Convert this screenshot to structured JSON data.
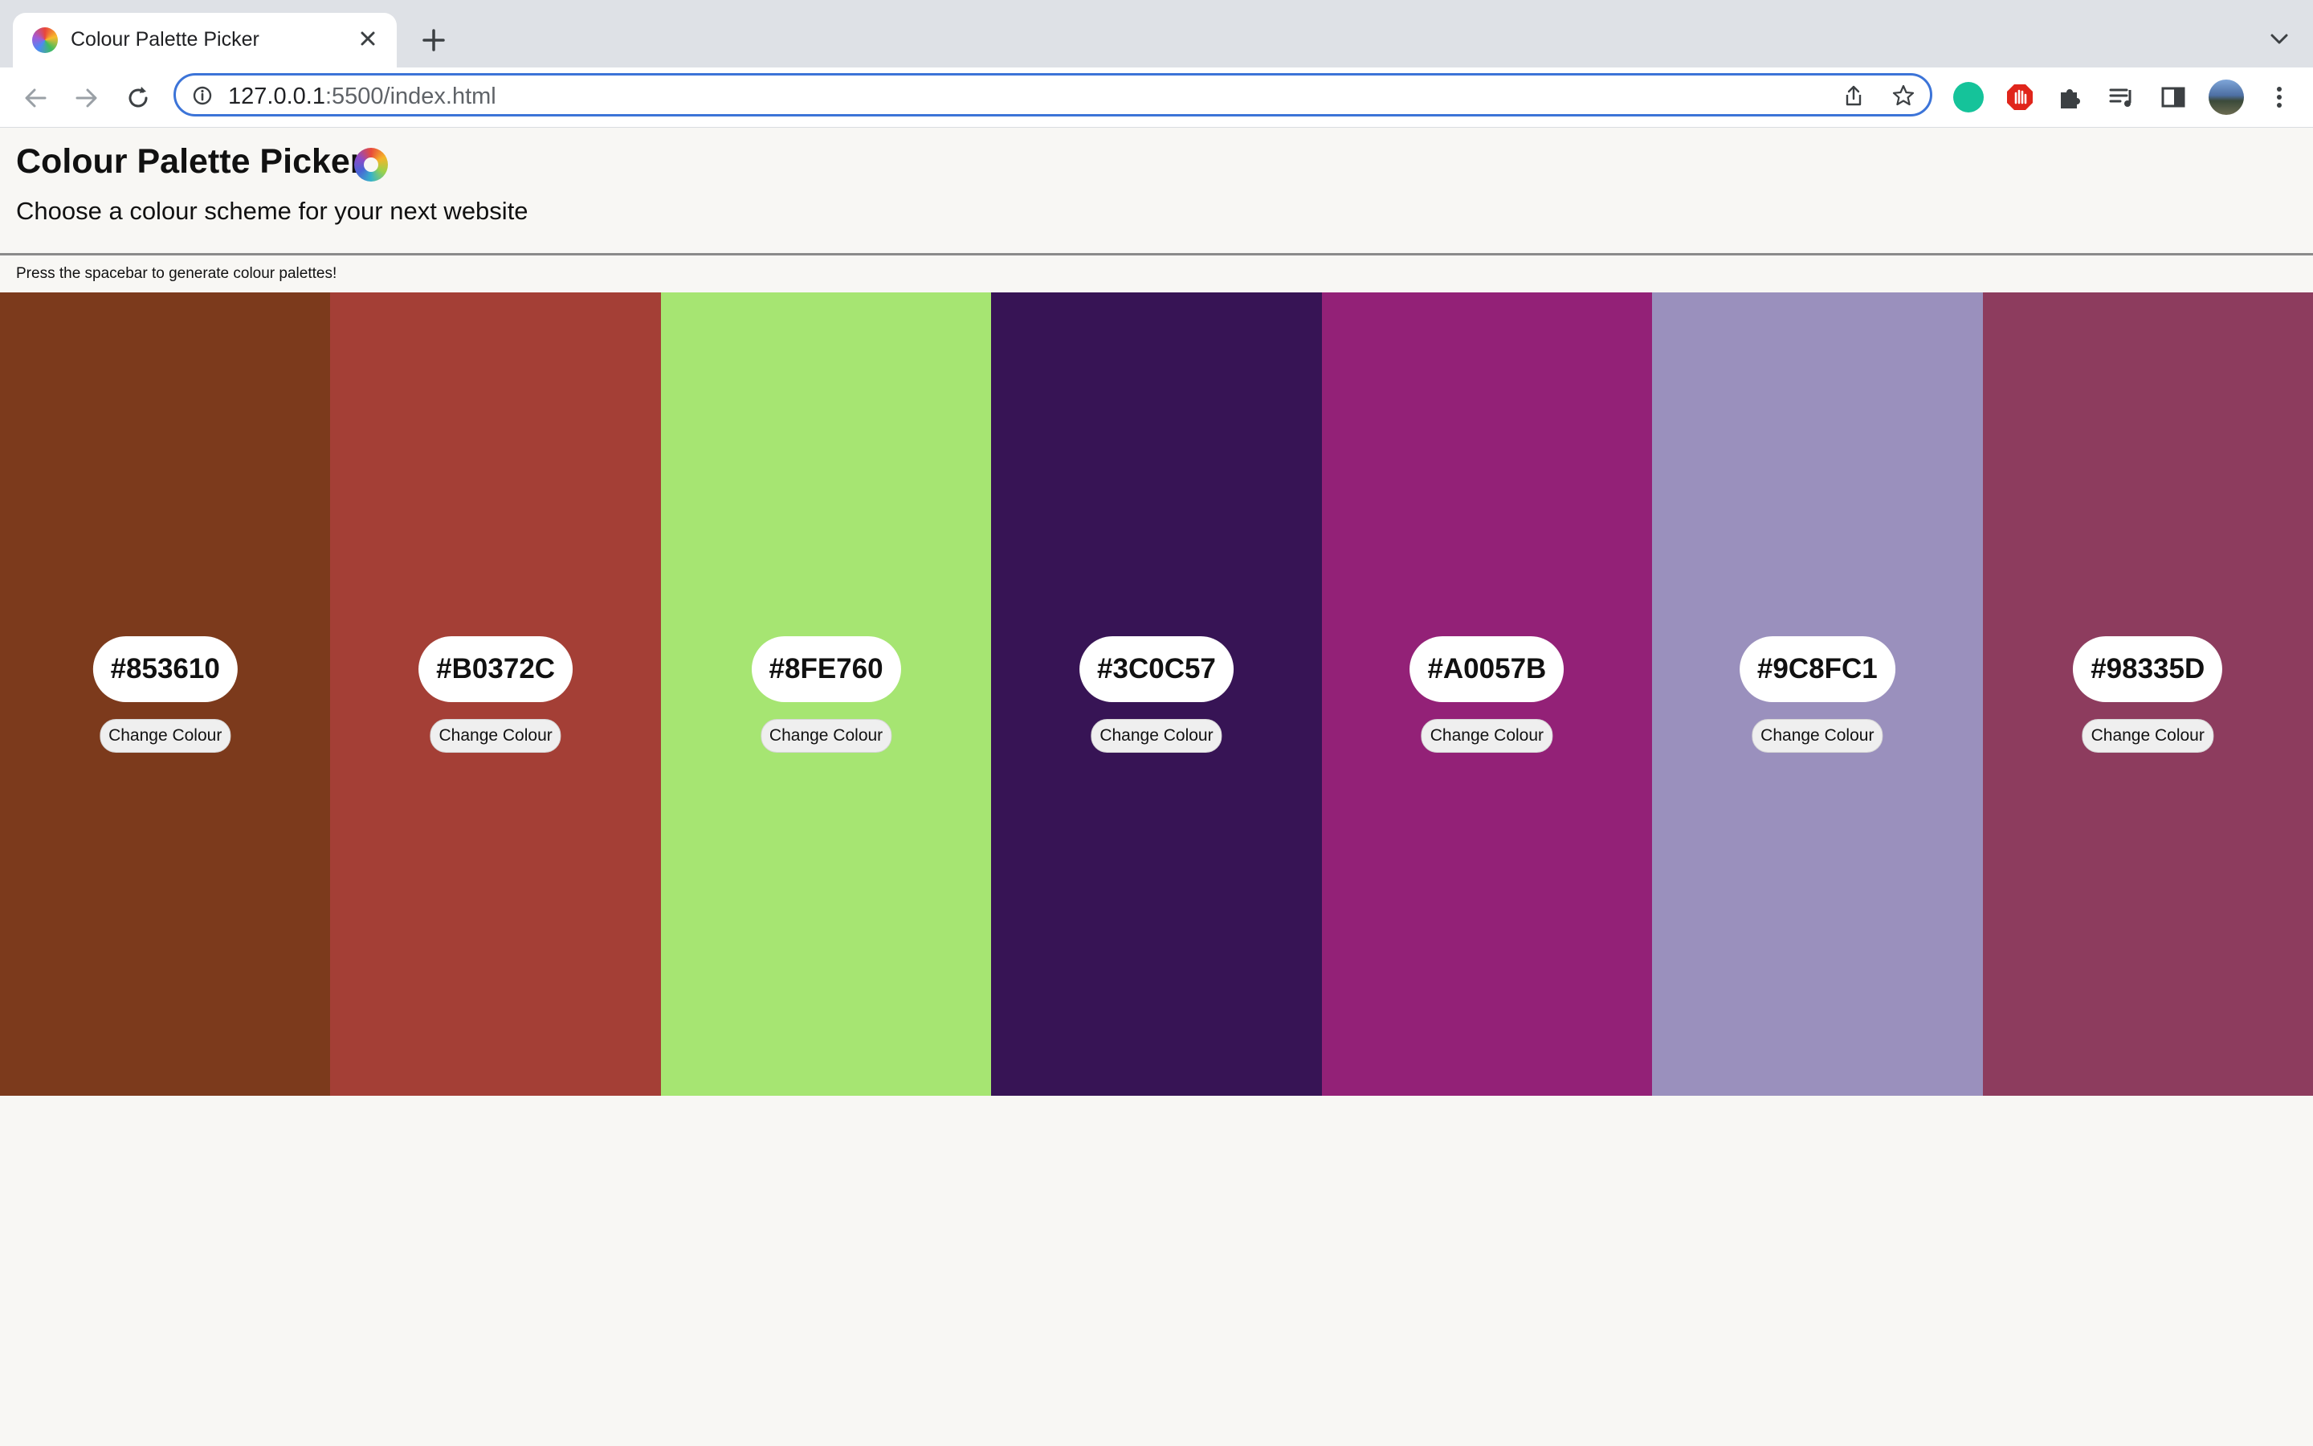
{
  "browser": {
    "tab_title": "Colour Palette Picker",
    "url_host": "127.0.0.1",
    "url_rest": ":5500/index.html"
  },
  "page": {
    "title": "Colour Palette Picker",
    "subtitle": "Choose a colour scheme for your next website",
    "hint": "Press the spacebar to generate colour palettes!"
  },
  "palette": [
    {
      "hex": "#853610",
      "color": "#7c3a1c",
      "button_label": "Change Colour"
    },
    {
      "hex": "#B0372C",
      "color": "#a43f36",
      "button_label": "Change Colour"
    },
    {
      "hex": "#8FE760",
      "color": "#a6e572",
      "button_label": "Change Colour"
    },
    {
      "hex": "#3C0C57",
      "color": "#371455",
      "button_label": "Change Colour"
    },
    {
      "hex": "#A0057B",
      "color": "#932177",
      "button_label": "Change Colour"
    },
    {
      "hex": "#9C8FC1",
      "color": "#9a90bd",
      "button_label": "Change Colour"
    },
    {
      "hex": "#98335D",
      "color": "#8d3c5e",
      "button_label": "Change Colour"
    }
  ],
  "icons": {
    "favicon": "colour-wheel-icon",
    "close": "close-icon",
    "new_tab": "plus-icon",
    "back": "back-arrow-icon",
    "forward": "forward-arrow-icon",
    "reload": "reload-icon",
    "info": "info-icon",
    "share": "share-icon",
    "star": "star-icon",
    "extension": "puzzle-icon",
    "media": "media-queue-icon",
    "side_panel": "side-panel-icon",
    "menu": "kebab-menu-icon"
  },
  "colors": {
    "accent": "#3c74d8",
    "page_background": "#f8f7f4"
  }
}
